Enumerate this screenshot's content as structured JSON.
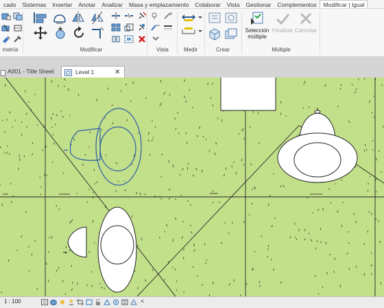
{
  "menu": {
    "items": [
      "cado",
      "Sistemas",
      "Insertar",
      "Anotar",
      "Analizar",
      "Masa y emplazamiento",
      "Colaborar",
      "Vista",
      "Gestionar",
      "Complementos",
      "Modificar | Igual"
    ],
    "active_index": 10
  },
  "ribbon": {
    "groups": {
      "geometry": "metría",
      "modify": "Modificar",
      "view": "Vista",
      "measure": "Medir",
      "create": "Crear",
      "multiple": "Múltiple"
    },
    "multi_select": {
      "line1": "Selección",
      "line2": "múltiple"
    },
    "finish_label": "Finalizar",
    "cancel_label": "Cancelar"
  },
  "tabs": [
    {
      "label": "A001 - Title Sheet",
      "icon": "sheet-icon",
      "active": false
    },
    {
      "label": "Level 1",
      "icon": "floor-plan-icon",
      "active": true
    }
  ],
  "tab_close": "✕",
  "status": {
    "scale": "1 : 100",
    "view_controls": "<"
  },
  "colors": {
    "canvas": "#c2e08a",
    "selected": "#2e5ba8",
    "accent": "#2b76c2"
  }
}
